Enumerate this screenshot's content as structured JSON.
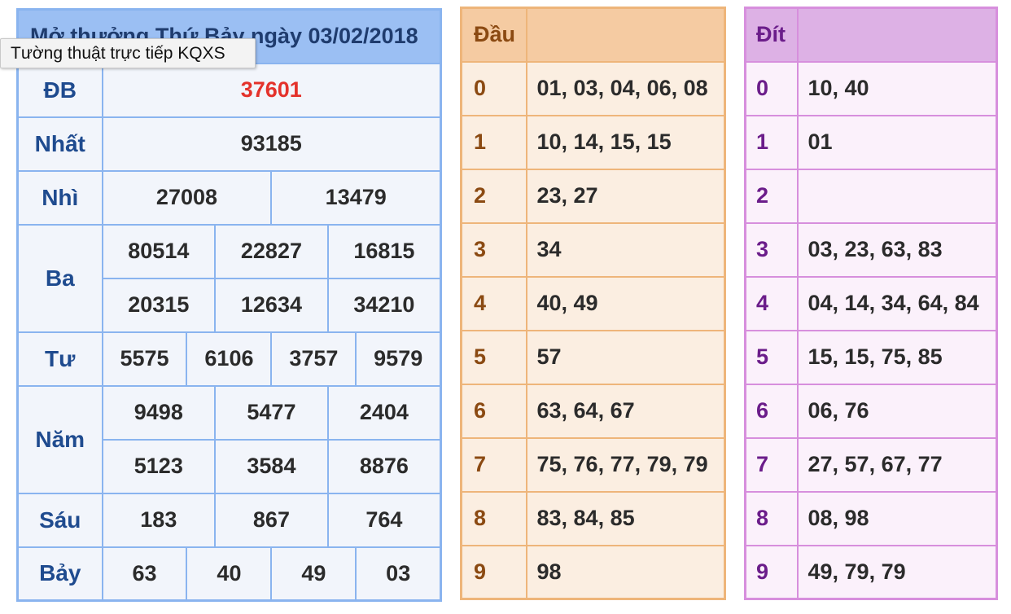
{
  "kqxs": {
    "title": "Mở thưởng Thứ Bảy ngày 03/02/2018",
    "special": {
      "label": "ĐB",
      "value": "37601"
    },
    "first": {
      "label": "Nhất",
      "value": "93185"
    },
    "second": {
      "label": "Nhì",
      "values": [
        "27008",
        "13479"
      ]
    },
    "third": {
      "label": "Ba",
      "values": [
        "80514",
        "22827",
        "16815",
        "20315",
        "12634",
        "34210"
      ]
    },
    "fourth": {
      "label": "Tư",
      "values": [
        "5575",
        "6106",
        "3757",
        "9579"
      ]
    },
    "fifth": {
      "label": "Năm",
      "values": [
        "9498",
        "5477",
        "2404",
        "5123",
        "3584",
        "8876"
      ]
    },
    "sixth": {
      "label": "Sáu",
      "values": [
        "183",
        "867",
        "764"
      ]
    },
    "seventh": {
      "label": "Bảy",
      "values": [
        "63",
        "40",
        "49",
        "03"
      ]
    }
  },
  "tooltip": "Tường thuật trực tiếp KQXS",
  "dau": {
    "header": "Đầu",
    "rows": [
      {
        "num": "0",
        "vals": "01, 03, 04, 06, 08"
      },
      {
        "num": "1",
        "vals": "10, 14, 15, 15"
      },
      {
        "num": "2",
        "vals": "23, 27"
      },
      {
        "num": "3",
        "vals": "34"
      },
      {
        "num": "4",
        "vals": "40, 49"
      },
      {
        "num": "5",
        "vals": "57"
      },
      {
        "num": "6",
        "vals": "63, 64, 67"
      },
      {
        "num": "7",
        "vals": "75, 76, 77, 79, 79"
      },
      {
        "num": "8",
        "vals": "83, 84, 85"
      },
      {
        "num": "9",
        "vals": "98"
      }
    ]
  },
  "dit": {
    "header": "Đít",
    "rows": [
      {
        "num": "0",
        "vals": "10, 40"
      },
      {
        "num": "1",
        "vals": "01"
      },
      {
        "num": "2",
        "vals": ""
      },
      {
        "num": "3",
        "vals": "03, 23, 63, 83"
      },
      {
        "num": "4",
        "vals": "04, 14, 34, 64, 84"
      },
      {
        "num": "5",
        "vals": "15, 15, 75, 85"
      },
      {
        "num": "6",
        "vals": "06, 76"
      },
      {
        "num": "7",
        "vals": "27, 57, 67, 77"
      },
      {
        "num": "8",
        "vals": "08, 98"
      },
      {
        "num": "9",
        "vals": "49, 79, 79"
      }
    ]
  },
  "colors": {
    "special_value": "#e4322b",
    "kqxs_border": "#8ab4ef",
    "dau_border": "#eeb57a",
    "dit_border": "#d78fdd"
  }
}
